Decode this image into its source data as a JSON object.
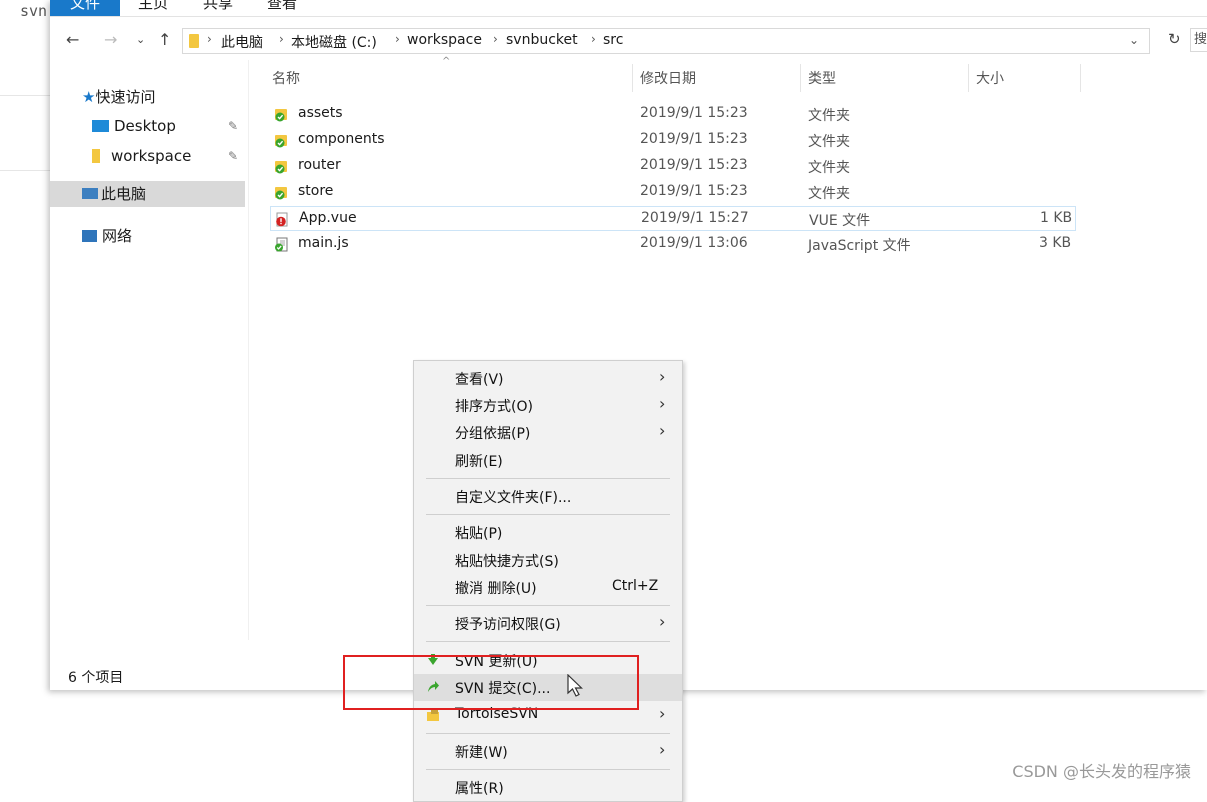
{
  "background": {
    "left_label": "svn"
  },
  "ribbon": {
    "tabs": [
      "文件",
      "主页",
      "共享",
      "查看"
    ]
  },
  "address": {
    "breadcrumbs": [
      "此电脑",
      "本地磁盘 (C:)",
      "workspace",
      "svnbucket",
      "src"
    ],
    "search_partial": "搜"
  },
  "sidebar": {
    "quick_access": "快速访问",
    "items": [
      {
        "label": "Desktop",
        "pinned": true
      },
      {
        "label": "workspace",
        "pinned": true
      }
    ],
    "this_pc": "此电脑",
    "network": "网络"
  },
  "columns": {
    "name": "名称",
    "date": "修改日期",
    "type": "类型",
    "size": "大小"
  },
  "files": [
    {
      "name": "assets",
      "date": "2019/9/1 15:23",
      "type": "文件夹",
      "size": "",
      "icon": "svn-normal-folder-icon"
    },
    {
      "name": "components",
      "date": "2019/9/1 15:23",
      "type": "文件夹",
      "size": "",
      "icon": "svn-normal-folder-icon"
    },
    {
      "name": "router",
      "date": "2019/9/1 15:23",
      "type": "文件夹",
      "size": "",
      "icon": "svn-normal-folder-icon"
    },
    {
      "name": "store",
      "date": "2019/9/1 15:23",
      "type": "文件夹",
      "size": "",
      "icon": "svn-normal-folder-icon"
    },
    {
      "name": "App.vue",
      "date": "2019/9/1 15:27",
      "type": "VUE 文件",
      "size": "1 KB",
      "icon": "svn-modified-file-icon"
    },
    {
      "name": "main.js",
      "date": "2019/9/1 13:06",
      "type": "JavaScript 文件",
      "size": "3 KB",
      "icon": "svn-normal-js-file-icon"
    }
  ],
  "status_bar": {
    "count": "6 个项目"
  },
  "context_menu": {
    "items": [
      {
        "label": "查看(V)",
        "submenu": true
      },
      {
        "label": "排序方式(O)",
        "submenu": true
      },
      {
        "label": "分组依据(P)",
        "submenu": true
      },
      {
        "label": "刷新(E)"
      },
      {
        "label": "自定义文件夹(F)..."
      },
      {
        "label": "粘贴(P)"
      },
      {
        "label": "粘贴快捷方式(S)"
      },
      {
        "label": "撤消 删除(U)",
        "shortcut": "Ctrl+Z"
      },
      {
        "label": "授予访问权限(G)",
        "submenu": true
      },
      {
        "label": "SVN 更新(U)",
        "icon": "svn-update-icon"
      },
      {
        "label": "SVN 提交(C)...",
        "icon": "svn-commit-icon",
        "highlighted": true
      },
      {
        "label": "TortoiseSVN",
        "icon": "tortoisesvn-icon",
        "submenu": true
      },
      {
        "label": "新建(W)",
        "submenu": true
      },
      {
        "label": "属性(R)"
      }
    ]
  },
  "colors": {
    "ribbon_file_tab": "#1979ca",
    "annotation_box": "#e02020",
    "svn_green": "#3aa52e",
    "svn_red": "#d42222"
  },
  "watermark": "CSDN @长头发的程序猿"
}
